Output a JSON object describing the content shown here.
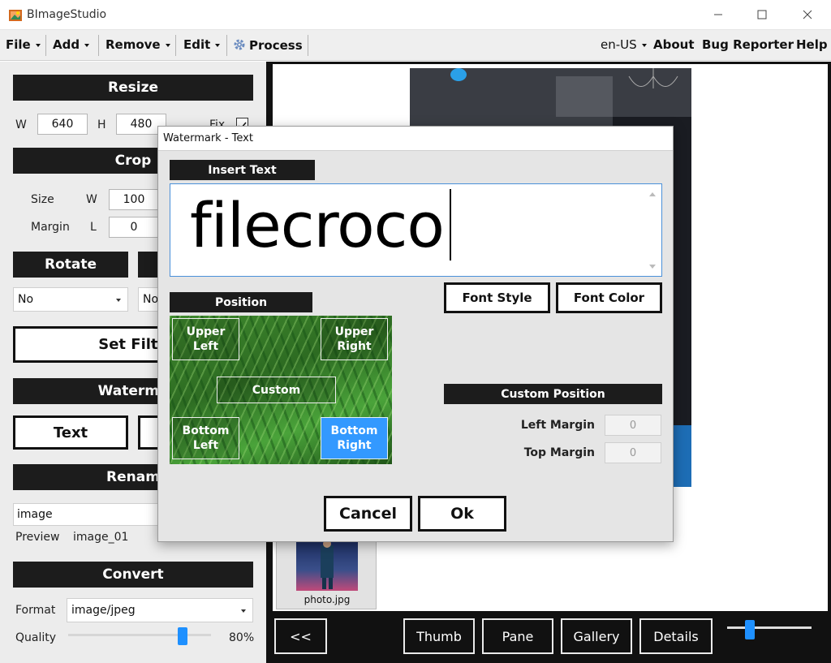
{
  "window": {
    "title": "BImageStudio"
  },
  "menu": {
    "file": "File",
    "add": "Add",
    "remove": "Remove",
    "edit": "Edit",
    "process": "Process",
    "language": "en-US",
    "about": "About",
    "bug_reporter": "Bug Reporter",
    "help": "Help"
  },
  "left_panel": {
    "resize": {
      "header": "Resize",
      "w_label": "W",
      "w_value": "640",
      "h_label": "H",
      "h_value": "480",
      "fix_label": "Fix"
    },
    "crop": {
      "header": "Crop",
      "size_label": "Size",
      "w_label": "W",
      "w_value": "100",
      "margin_label": "Margin",
      "l_label": "L",
      "l_value": "0"
    },
    "rotate": {
      "header": "Rotate",
      "value": "No"
    },
    "filter_select": {
      "value": "No"
    },
    "set_filter": "Set Filte",
    "watermark": {
      "header": "Waterma",
      "text_button": "Text"
    },
    "rename": {
      "header": "Renam",
      "value": "image",
      "preview_label": "Preview",
      "preview_value": "image_01"
    },
    "convert": {
      "header": "Convert",
      "format_label": "Format",
      "format_value": "image/jpeg",
      "quality_label": "Quality",
      "quality_value": "80%",
      "quality_level": 0.8
    }
  },
  "thumbnail": {
    "label": "photo.jpg"
  },
  "bottom_bar": {
    "back": "<<",
    "thumb": "Thumb",
    "pane": "Pane",
    "gallery": "Gallery",
    "details": "Details"
  },
  "dialog": {
    "title": "Watermark - Text",
    "insert_text_header": "Insert Text",
    "text_value": "filecroco",
    "font_style": "Font Style",
    "font_color": "Font Color",
    "position_header": "Position",
    "positions": {
      "upper_left": "Upper Left",
      "upper_right": "Upper Right",
      "custom": "Custom",
      "bottom_left": "Bottom Left",
      "bottom_right": "Bottom Right"
    },
    "selected_position": "Bottom Right",
    "custom_position_header": "Custom Position",
    "left_margin_label": "Left Margin",
    "left_margin_value": "0",
    "top_margin_label": "Top Margin",
    "top_margin_value": "0",
    "cancel": "Cancel",
    "ok": "Ok"
  },
  "colors": {
    "accent": "#3399ff",
    "section_bg": "#1c1c1c",
    "panel_bg": "#ececec"
  }
}
